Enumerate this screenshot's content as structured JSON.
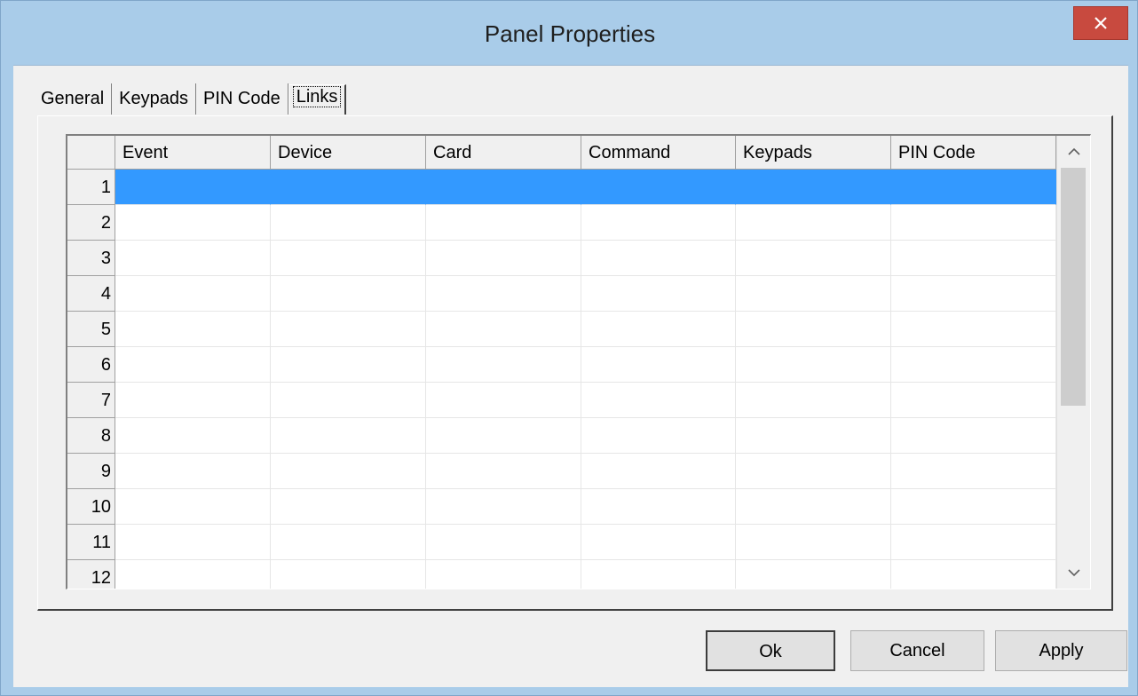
{
  "window": {
    "title": "Panel Properties"
  },
  "tabs": [
    {
      "label": "General"
    },
    {
      "label": "Keypads"
    },
    {
      "label": "PIN Code"
    },
    {
      "label": "Links",
      "active": true
    }
  ],
  "grid": {
    "columns": [
      "Event",
      "Device",
      "Card",
      "Command",
      "Keypads",
      "PIN Code"
    ],
    "rows": [
      "1",
      "2",
      "3",
      "4",
      "5",
      "6",
      "7",
      "8",
      "9",
      "10",
      "11",
      "12"
    ],
    "selected_row": "1"
  },
  "buttons": {
    "ok": "Ok",
    "cancel": "Cancel",
    "apply": "Apply"
  },
  "icons": {
    "close": "close-icon",
    "scroll_up": "chevron-up-icon",
    "scroll_down": "chevron-down-icon"
  },
  "colors": {
    "selection": "#3399ff",
    "close_button": "#c84a3f",
    "frame": "#a9cce9"
  }
}
